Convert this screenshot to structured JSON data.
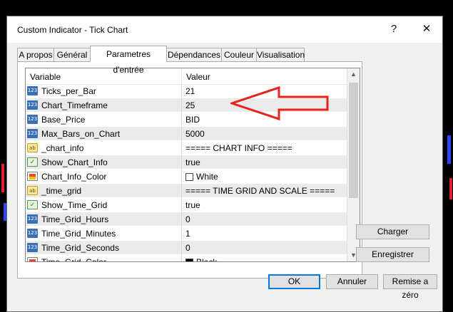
{
  "window": {
    "title": "Custom Indicator - Tick Chart",
    "help_glyph": "?",
    "close_glyph": "✕"
  },
  "tabs": [
    {
      "label": "A propos"
    },
    {
      "label": "Général"
    },
    {
      "label": "Parametres d'entrée"
    },
    {
      "label": "Dépendances"
    },
    {
      "label": "Couleur"
    },
    {
      "label": "Visualisation"
    }
  ],
  "table": {
    "col_variable": "Variable",
    "col_value": "Valeur",
    "rows": [
      {
        "icon": "int-icon",
        "name": "Ticks_per_Bar",
        "value": "21"
      },
      {
        "icon": "int-icon",
        "name": "Chart_Timeframe",
        "value": "25"
      },
      {
        "icon": "int-icon",
        "name": "Base_Price",
        "value": "BID"
      },
      {
        "icon": "int-icon",
        "name": "Max_Bars_on_Chart",
        "value": "5000"
      },
      {
        "icon": "string-icon",
        "name": "_chart_info",
        "value": "===== CHART INFO ====="
      },
      {
        "icon": "bool-icon",
        "name": "Show_Chart_Info",
        "value": "true"
      },
      {
        "icon": "color-icon",
        "name": "Chart_Info_Color",
        "value": "White"
      },
      {
        "icon": "string-icon",
        "name": "_time_grid",
        "value": "===== TIME GRID AND SCALE ====="
      },
      {
        "icon": "bool-icon",
        "name": "Show_Time_Grid",
        "value": "true"
      },
      {
        "icon": "int-icon",
        "name": "Time_Grid_Hours",
        "value": "0"
      },
      {
        "icon": "int-icon",
        "name": "Time_Grid_Minutes",
        "value": "1"
      },
      {
        "icon": "int-icon",
        "name": "Time_Grid_Seconds",
        "value": "0"
      },
      {
        "icon": "color-icon",
        "name": "Time_Grid_Color",
        "value": "Black"
      }
    ]
  },
  "buttons": {
    "load": "Charger",
    "save": "Enregistrer",
    "ok": "OK",
    "cancel": "Annuler",
    "reset": "Remise a zéro"
  },
  "colors": {
    "arrow_red": "#e8231c",
    "accent_blue": "#0078d7",
    "white_swatch": "#ffffff",
    "black_swatch": "#000000"
  }
}
